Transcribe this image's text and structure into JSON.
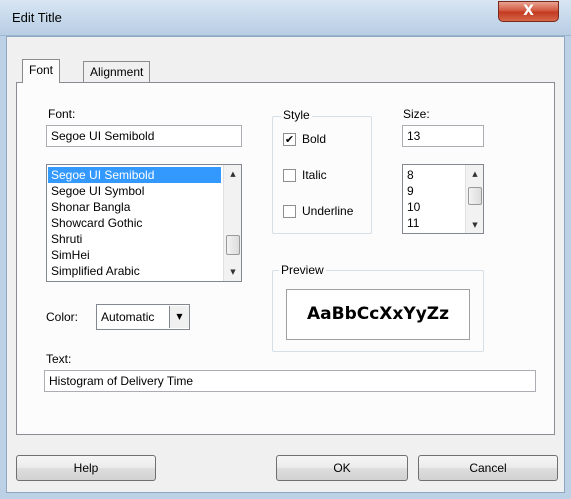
{
  "window": {
    "title": "Edit Title",
    "close_glyph": "X"
  },
  "tabs": [
    {
      "label": "Font",
      "active": true
    },
    {
      "label": "Alignment",
      "active": false
    }
  ],
  "font": {
    "label": "Font:",
    "value": "Segoe UI Semibold",
    "list": [
      "Segoe UI Semibold",
      "Segoe UI Symbol",
      "Shonar Bangla",
      "Showcard Gothic",
      "Shruti",
      "SimHei",
      "Simplified Arabic"
    ],
    "selected_index": 0
  },
  "style": {
    "caption": "Style",
    "bold": {
      "label": "Bold",
      "checked": true
    },
    "italic": {
      "label": "Italic",
      "checked": false
    },
    "underline": {
      "label": "Underline",
      "checked": false
    }
  },
  "size": {
    "label": "Size:",
    "value": "13",
    "list": [
      "8",
      "9",
      "10",
      "11"
    ]
  },
  "color": {
    "label": "Color:",
    "value": "Automatic"
  },
  "preview": {
    "caption": "Preview",
    "sample": "AaBbCcXxYyZz"
  },
  "text": {
    "label": "Text:",
    "value": "Histogram of Delivery Time"
  },
  "buttons": {
    "help": "Help",
    "ok": "OK",
    "cancel": "Cancel"
  },
  "icons": {
    "close": "close-icon",
    "dropdown": "chevron-down-icon",
    "check": "checkmark-icon"
  }
}
